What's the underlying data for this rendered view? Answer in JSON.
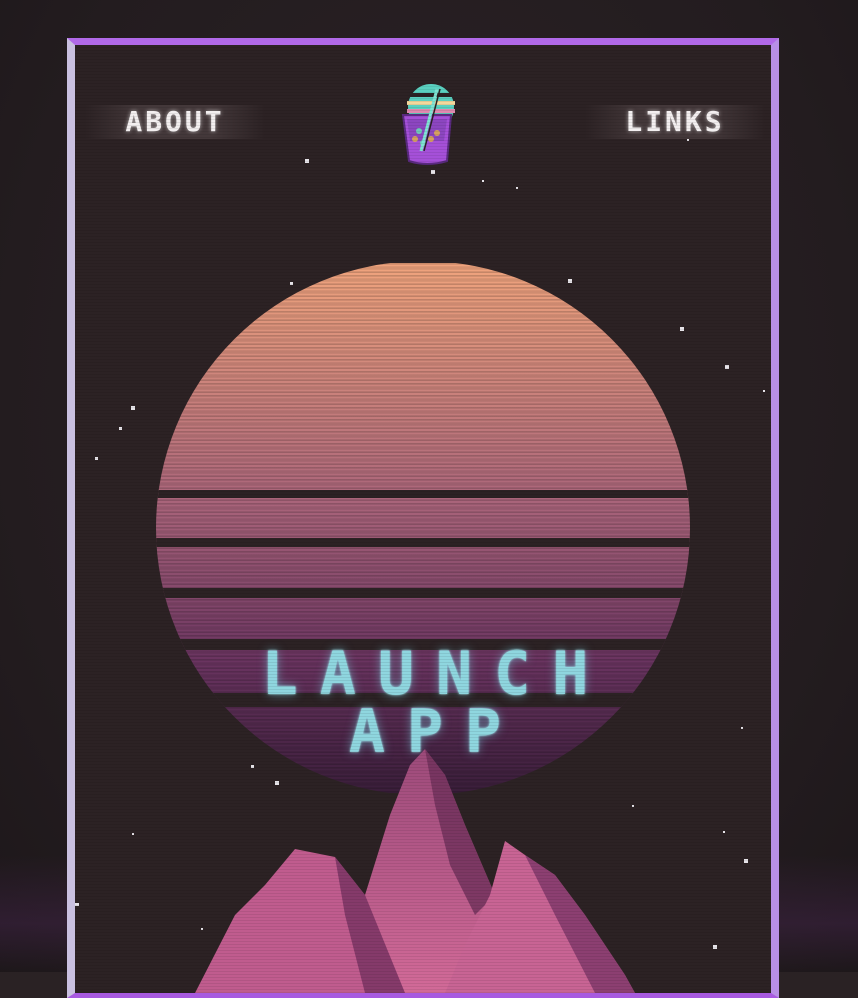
{
  "nav": {
    "about_label": "ABOUT",
    "links_label": "LINKS"
  },
  "hero": {
    "launch_line1": "LAUNCH",
    "launch_line2": "APP"
  },
  "logo": {
    "icon": "bubble-tea-cup-icon"
  },
  "colors": {
    "frame_purple": "#b169e8",
    "background": "#2c2224",
    "sun_top": "#f0a47d",
    "sun_bottom": "#4a2447",
    "launch_text": "#8fd6df",
    "mountain": "#b75a8a"
  }
}
